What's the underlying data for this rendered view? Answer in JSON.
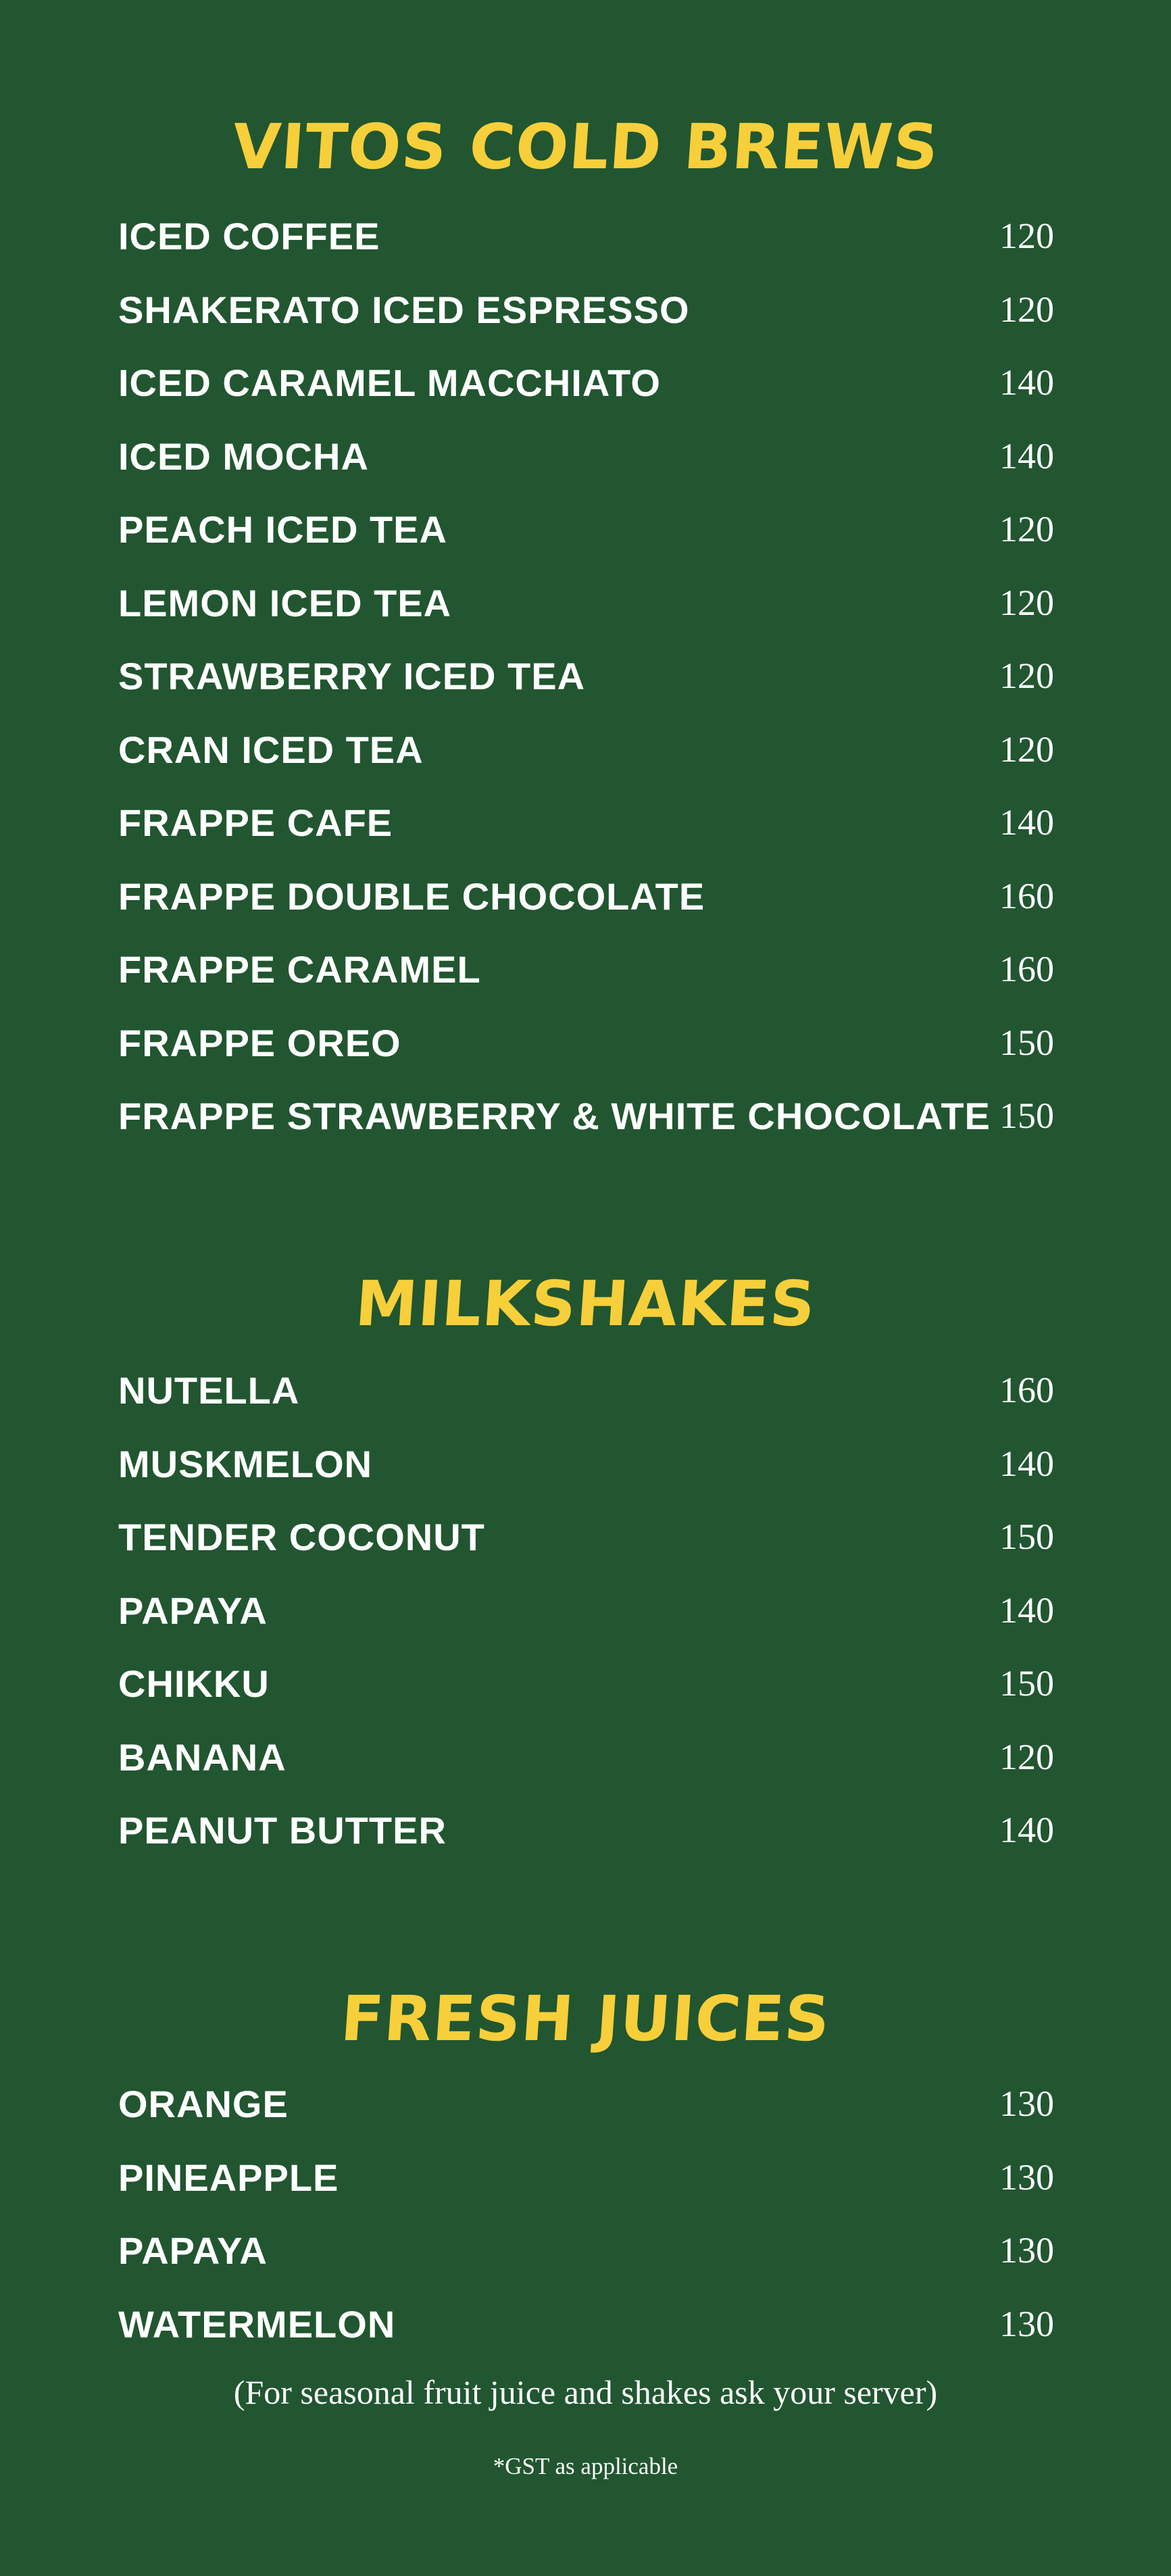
{
  "sections": [
    {
      "title": "VITOS COLD BREWS",
      "items": [
        {
          "name": "ICED COFFEE",
          "price": "120"
        },
        {
          "name": "SHAKERATO ICED ESPRESSO",
          "price": "120"
        },
        {
          "name": "ICED CARAMEL MACCHIATO",
          "price": "140"
        },
        {
          "name": "ICED MOCHA",
          "price": "140"
        },
        {
          "name": "PEACH ICED TEA",
          "price": "120"
        },
        {
          "name": "LEMON ICED TEA",
          "price": "120"
        },
        {
          "name": "STRAWBERRY ICED TEA",
          "price": "120"
        },
        {
          "name": "CRAN ICED TEA",
          "price": "120"
        },
        {
          "name": "FRAPPE CAFE",
          "price": "140"
        },
        {
          "name": "FRAPPE DOUBLE CHOCOLATE",
          "price": "160"
        },
        {
          "name": "FRAPPE CARAMEL",
          "price": "160"
        },
        {
          "name": "FRAPPE OREO",
          "price": "150"
        },
        {
          "name": "FRAPPE STRAWBERRY & WHITE CHOCOLATE",
          "price": "150"
        }
      ]
    },
    {
      "title": "MILKSHAKES",
      "items": [
        {
          "name": "NUTELLA",
          "price": "160"
        },
        {
          "name": "MUSKMELON",
          "price": "140"
        },
        {
          "name": "TENDER COCONUT",
          "price": "150"
        },
        {
          "name": "PAPAYA",
          "price": "140"
        },
        {
          "name": "CHIKKU",
          "price": "150"
        },
        {
          "name": "BANANA",
          "price": "120"
        },
        {
          "name": "PEANUT BUTTER",
          "price": "140"
        }
      ]
    },
    {
      "title": "FRESH JUICES",
      "items": [
        {
          "name": "ORANGE",
          "price": "130"
        },
        {
          "name": "PINEAPPLE",
          "price": "130"
        },
        {
          "name": "PAPAYA",
          "price": "130"
        },
        {
          "name": "WATERMELON",
          "price": "130"
        }
      ]
    }
  ],
  "seasonal_note": "(For seasonal fruit juice and shakes  ask your server)",
  "gst_note": "*GST as applicable",
  "colors": {
    "background": "#215630",
    "heading": "#f7cf3a",
    "text": "#ffffff"
  }
}
